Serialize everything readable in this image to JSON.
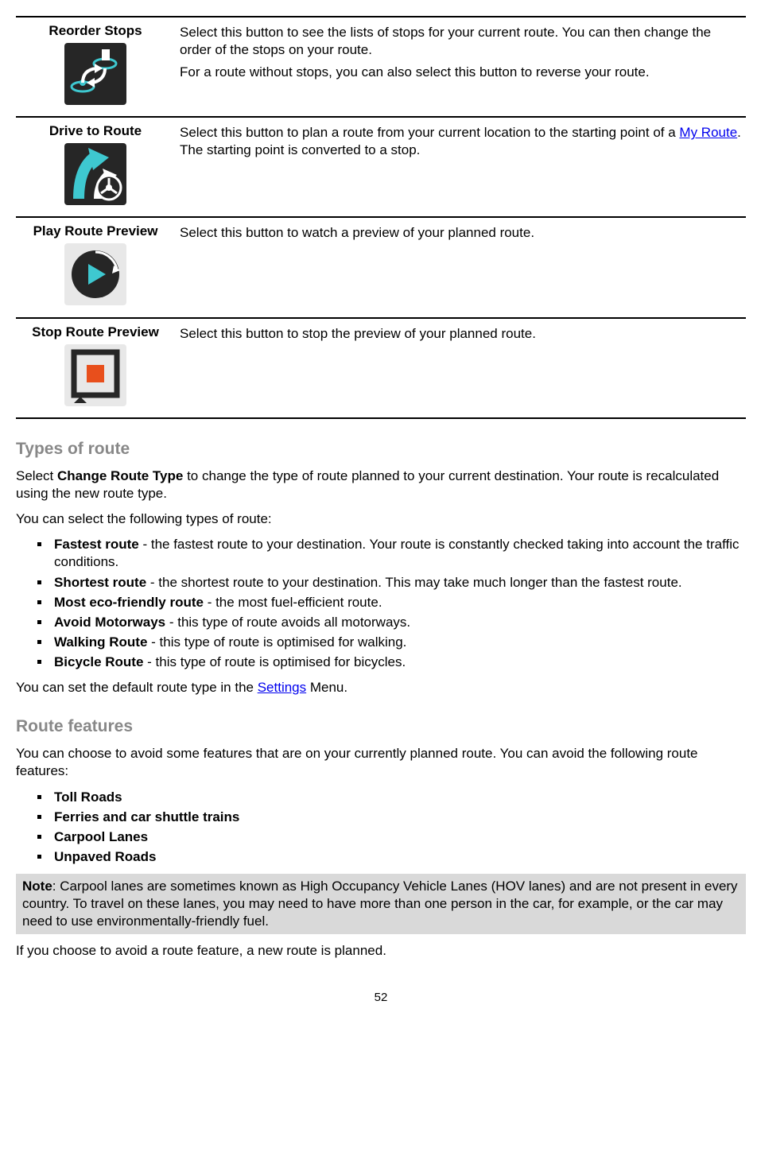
{
  "rows": [
    {
      "title": "Reorder Stops",
      "desc1": "Select this button to see the lists of stops for your current route. You can then change the order of the stops on your route.",
      "desc2": "For a route without stops, you can also select this button to reverse your route."
    },
    {
      "title": "Drive to Route",
      "desc_pre": "Select this button to plan a route from your current location to the starting point of a ",
      "link": "My Route",
      "desc_post": ". The starting point is converted to a stop."
    },
    {
      "title": "Play Route Preview",
      "desc1": "Select this button to watch a preview of your planned route."
    },
    {
      "title": "Stop Route Preview",
      "desc1": "Select this button to stop the preview of your planned route."
    }
  ],
  "types_heading": "Types of route",
  "types_intro_pre": "Select ",
  "types_intro_bold": "Change Route Type",
  "types_intro_post": " to change the type of route planned to your current destination. Your route is recalculated using the new route type.",
  "types_select": "You can select the following types of route:",
  "route_types": [
    {
      "bold": "Fastest route",
      "rest": " - the fastest route to your destination. Your route is constantly checked taking into account the traffic conditions."
    },
    {
      "bold": "Shortest route",
      "rest": " - the shortest route to your destination. This may take much longer than the fastest route."
    },
    {
      "bold": "Most eco-friendly route",
      "rest": " - the most fuel-efficient route."
    },
    {
      "bold": "Avoid Motorways",
      "rest": " - this type of route avoids all motorways."
    },
    {
      "bold": "Walking Route",
      "rest": " - this type of route is optimised for walking."
    },
    {
      "bold": "Bicycle Route",
      "rest": " - this type of route is optimised for bicycles."
    }
  ],
  "types_outro_pre": "You can set the default route type in the ",
  "types_outro_link": "Settings",
  "types_outro_post": " Menu.",
  "features_heading": "Route features",
  "features_intro": "You can choose to avoid some features that are on your currently planned route. You can avoid the following route features:",
  "feature_list": [
    "Toll Roads",
    "Ferries and car shuttle trains",
    "Carpool Lanes",
    "Unpaved Roads"
  ],
  "note_bold": "Note",
  "note_text": ": Carpool lanes are sometimes known as High Occupancy Vehicle Lanes (HOV lanes) and are not present in every country. To travel on these lanes, you may need to have more than one person in the car, for example, or the car may need to use environmentally-friendly fuel.",
  "features_outro": "If you choose to avoid a route feature, a new route is planned.",
  "page_number": "52"
}
